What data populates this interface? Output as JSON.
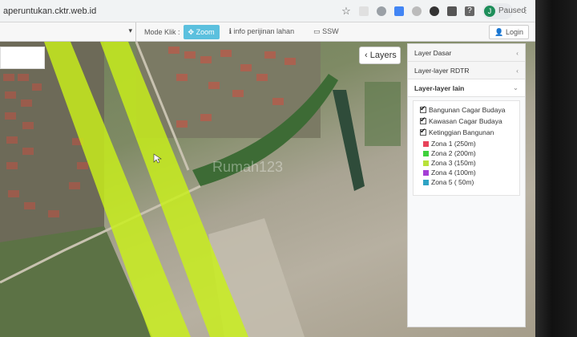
{
  "browser": {
    "url": "aperuntukan.cktr.web.id",
    "profile_initial": "J",
    "profile_status": "Paused"
  },
  "toolbar": {
    "mode_label": "Mode Klik :",
    "zoom_label": "Zoom",
    "info_label": "info perijinan lahan",
    "ssw_label": "SSW",
    "login_label": "Login"
  },
  "map": {
    "layers_tab_label": "Layers",
    "watermark": "Rumah123"
  },
  "panel": {
    "sections": [
      {
        "label": "Layer Dasar"
      },
      {
        "label": "Layer-layer RDTR"
      },
      {
        "label": "Layer-layer lain"
      }
    ],
    "checkboxes": [
      {
        "label": "Bangunan Cagar Budaya"
      },
      {
        "label": "Kawasan Cagar Budaya"
      },
      {
        "label": "Ketinggian Bangunan"
      }
    ],
    "legend": [
      {
        "label": "Zona 1 (250m)",
        "color": "#e8435a"
      },
      {
        "label": "Zona 2 (200m)",
        "color": "#3fd13b"
      },
      {
        "label": "Zona 3 (150m)",
        "color": "#b8e23a"
      },
      {
        "label": "Zona 4 (100m)",
        "color": "#a43fd6"
      },
      {
        "label": "Zona 5 ( 50m)",
        "color": "#2fa3c4"
      }
    ]
  }
}
